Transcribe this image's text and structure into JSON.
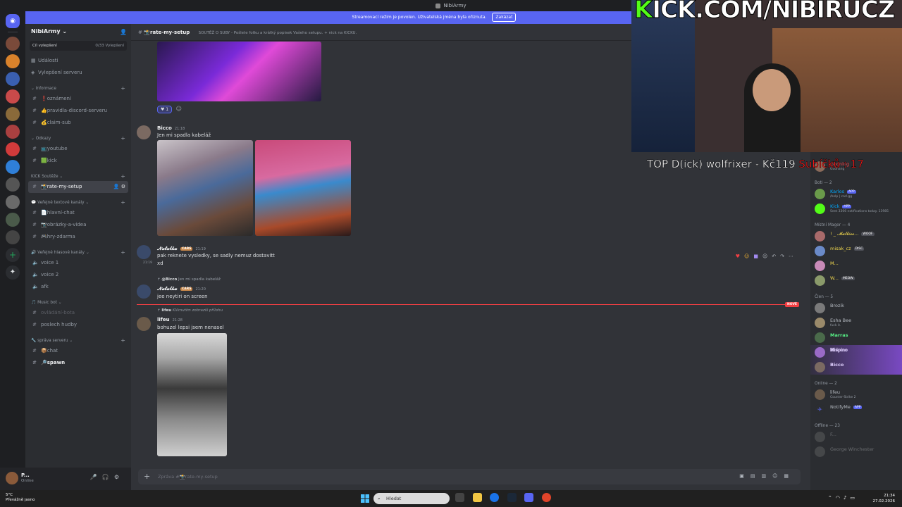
{
  "window": {
    "title": "NibiArmy"
  },
  "banner": {
    "text": "Streamovací režim je povolen. Uživatelská jména byla ořiznuta.",
    "button": "Zakázat"
  },
  "server": {
    "name": "NibiArmy",
    "boost_label": "Cíl vylepšení",
    "boost_count": "0/33 Vylepšení",
    "shortcuts": [
      "Události",
      "Vylepšení serveru"
    ]
  },
  "categories": [
    {
      "name": "Informace",
      "channels": [
        "❗oznámení",
        "👍pravidla-discord-serveru",
        "💰claim-sub"
      ]
    },
    {
      "name": "Odkazy",
      "channels": [
        "📺youtube",
        "🟩kick"
      ]
    },
    {
      "name": "KICK Soutěže",
      "channels": [
        "📸rate-my-setup"
      ]
    },
    {
      "name": "Veřejné textové kanály",
      "channels": [
        "📄hlavní-chat",
        "📷obrázky-a-videa",
        "🎮hry-zdarma"
      ]
    },
    {
      "name": "Veřejné hlasové kanály",
      "channels": [
        "voice 1",
        "voice 2",
        "afk"
      ]
    },
    {
      "name": "Music bot",
      "channels": [
        "ovládání-bota",
        "poslech hudby"
      ]
    },
    {
      "name": "správa serveru",
      "channels": [
        "📦chat",
        "🔎spawn"
      ]
    }
  ],
  "user": {
    "name": "P...",
    "status": "Online"
  },
  "channel_header": {
    "name": "📸rate-my-setup",
    "description": "SOUTĚŽ O SUBY - Pošlete fotku a krátký popisek Vašeho setupu. + nick na KICKU."
  },
  "messages": [
    {
      "reaction_count": "1"
    },
    {
      "author": "Bicco",
      "time": "21:18",
      "text": "Jen mi spadla kabeláž"
    },
    {
      "author": "𝓝𝓪𝓽𝓪𝓵𝓴𝓪",
      "tag": "CARS",
      "time": "21:19",
      "text": "pak reknete vysledky, se sadly nemuz dostavitt",
      "extra": "xd",
      "side_time": "21:19"
    },
    {
      "reply_to": "@Bicco",
      "reply_text": "Jen mi spadla kabeláž",
      "author": "𝓝𝓪𝓽𝓪𝓵𝓴𝓪",
      "tag": "CARS",
      "time": "21:20",
      "text": "jee neytiri on screen"
    },
    {
      "reply_to": "lifeu",
      "reply_text": "Kliknutím zobrazíš přílohu",
      "author": "lifeu",
      "time": "21:28",
      "text": "bohuzel lepsi jsem nenasel"
    }
  ],
  "new_marker": "NOVÉ",
  "composer": {
    "placeholder": "Zpráva #📸rate-my-setup"
  },
  "stream": {
    "title_k": "K",
    "title_rest": "ICK.COM/NIBIRUCZ",
    "overlay_top": "TOP D(ick) wolfrixer - Kč119",
    "overlay_subs": "Subíčků : 17"
  },
  "members": {
    "top": [
      {
        "name": "Goonlng",
        "sub": "Goonang"
      }
    ],
    "boti_header": "Boti — 2",
    "boti": [
      {
        "name": "Karlos",
        "badge": "APP",
        "sub": "/help | carl.gg",
        "color": "#00a8fc"
      },
      {
        "name": "Kick",
        "badge": "APP",
        "sub": "Sent 3306 notifications today. 13985",
        "color": "#00a8fc"
      }
    ],
    "magor_header": "Místní Magor — 4",
    "magor": [
      {
        "name": "! _ 𝓜𝓪𝓵𝓵𝓲𝓮𝓮...",
        "badge": "WOOF",
        "color": "#f2d94e"
      },
      {
        "name": "misak_cz",
        "badge": "DISC",
        "color": "#f2d94e"
      },
      {
        "name": "M...",
        "color": "#f2d94e"
      },
      {
        "name": "W...",
        "badge": "MEOW",
        "color": "#f2d94e"
      }
    ],
    "clen_header": "Člen — 5",
    "clen": [
      {
        "name": "Brozik",
        "color": "#b5bac1"
      },
      {
        "name": "Esha Bee",
        "sub": "fuck it.",
        "color": "#b5bac1"
      },
      {
        "name": "Marras",
        "color": "#57f287"
      },
      {
        "name": "𝐌𝐢𝐬̌𝐩𝐢𝐧𝐨",
        "color": "#b5bac1"
      },
      {
        "name": "Bicco",
        "color": "#b5bac1"
      }
    ],
    "online_header": "Online — 2",
    "online": [
      {
        "name": "lifeu",
        "sub": "Counter-Strike 2",
        "color": "#b5bac1"
      },
      {
        "name": "NotifyMe",
        "badge": "APP",
        "color": "#b5bac1"
      }
    ],
    "offline_header": "Offline — 23",
    "offline": [
      {
        "name": "F..."
      },
      {
        "name": "George Winchester"
      }
    ]
  },
  "taskbar": {
    "weather_temp": "5°C",
    "weather_desc": "Převážně jasno",
    "search_placeholder": "Hledat",
    "time": "21:34",
    "date": "27.02.2026"
  }
}
